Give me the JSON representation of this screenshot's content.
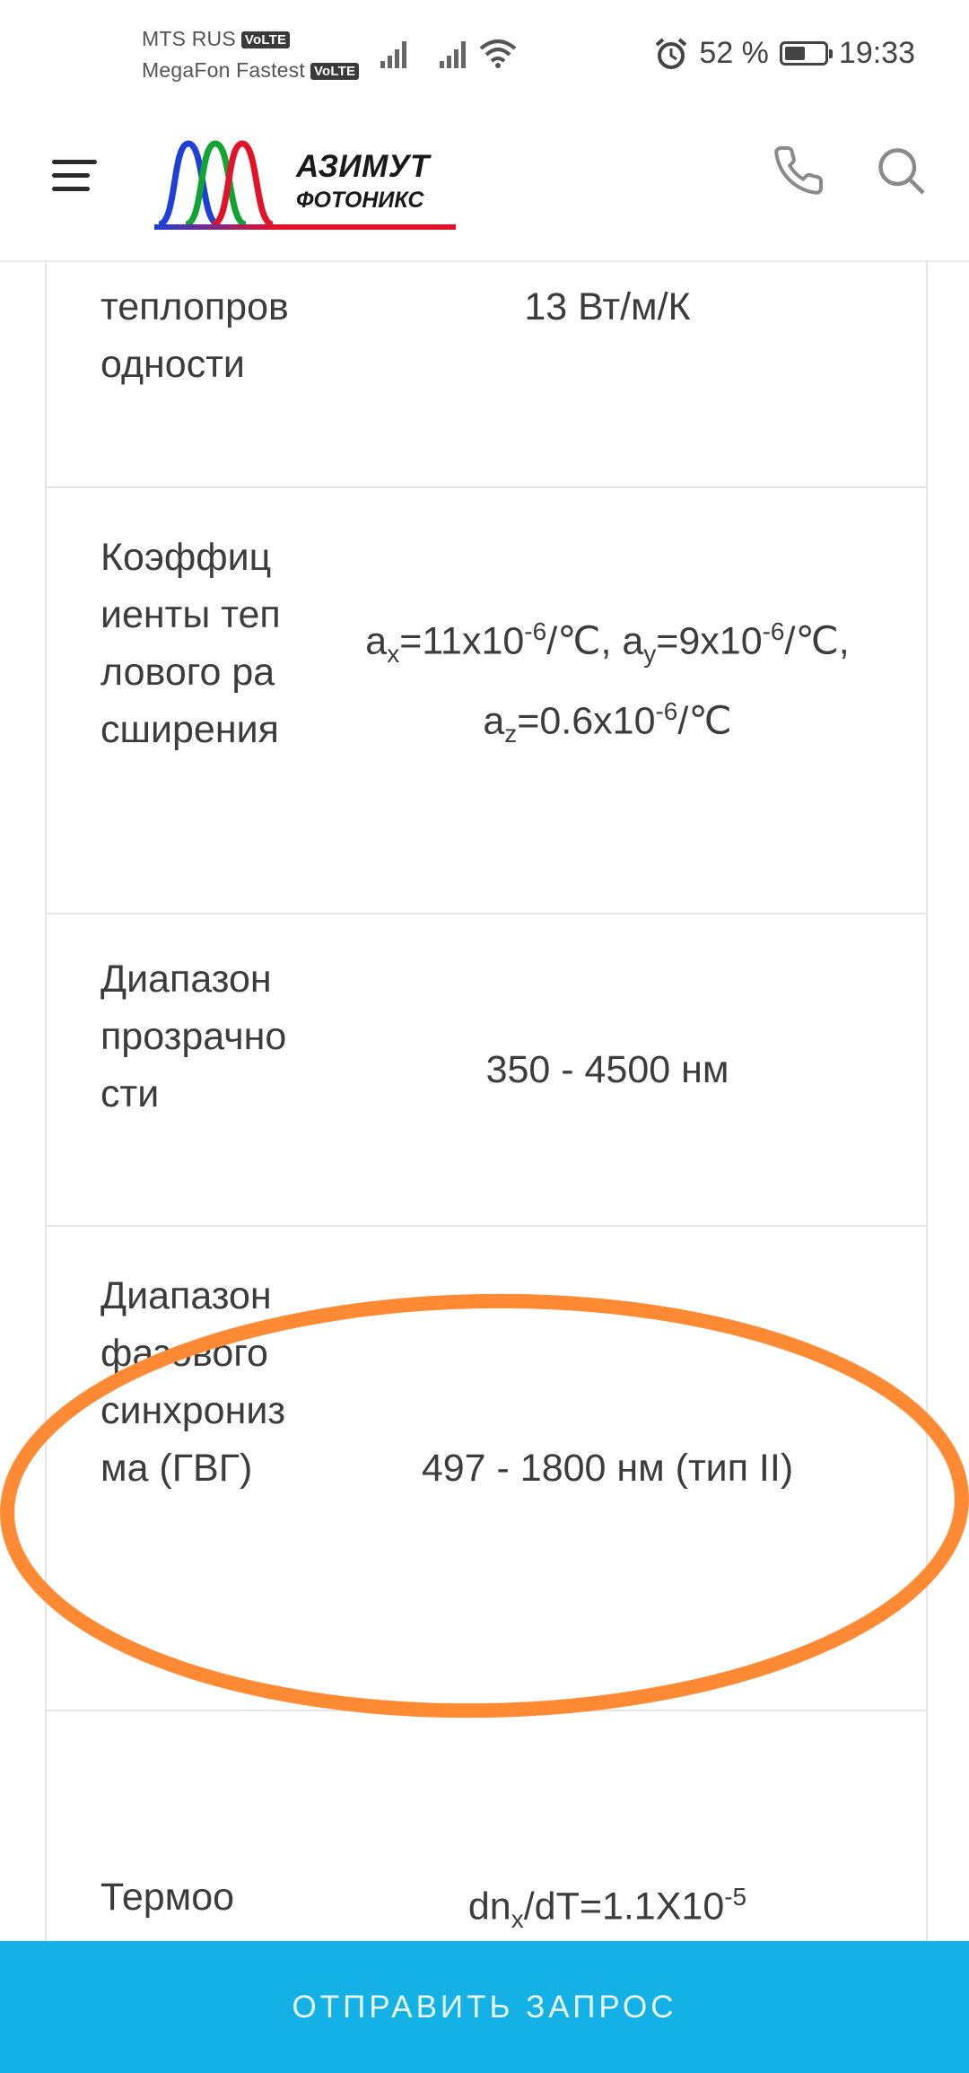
{
  "status_bar": {
    "carrier1": "MTS RUS",
    "carrier2": "MegaFon Fastest",
    "volte": "VoLTE",
    "battery_text": "52 %",
    "battery_level": 0.52,
    "time": "19:33",
    "icons": [
      "alarm-icon",
      "signal-icon",
      "wifi-icon",
      "battery-icon"
    ]
  },
  "header": {
    "logo_line1": "АЗИМУТ",
    "logo_line2": "ФОТОНИКС",
    "icons": [
      "menu-icon",
      "phone-icon",
      "search-icon"
    ],
    "logo_colors": [
      "#1f3fd6",
      "#12a335",
      "#e0132a"
    ]
  },
  "table": {
    "rows": [
      {
        "label": "теплопроводности",
        "value": "13 Вт/м/К"
      },
      {
        "label": "Коэффициенты теплового расширения",
        "value_parts": {
          "ax": "a",
          "ax_sub": "x",
          "ax_val": "=11x10",
          "exp1": "-6",
          "unit1": "/℃, a",
          "ay_sub": "y",
          "ay_val": "=9x10",
          "exp2": "-6",
          "unit2": "/℃, a",
          "az_sub": "z",
          "az_val": "=0.6x10",
          "exp3": "-6",
          "unit3": "/℃"
        }
      },
      {
        "label": "Диапазон прозрачности",
        "value": "350 - 4500 нм"
      },
      {
        "label": "Диапазон фазового синхронизма (ГВГ)",
        "value": "497 - 1800 нм (тип II)"
      },
      {
        "label": "Термоо",
        "value_parts": {
          "pre": "dn",
          "sub": "x",
          "mid": "/dT=1.1X10",
          "exp": "-5"
        }
      }
    ]
  },
  "annotation_color": "#ff8a33",
  "cta": {
    "label": "ОТПРАВИТЬ ЗАПРОС"
  }
}
